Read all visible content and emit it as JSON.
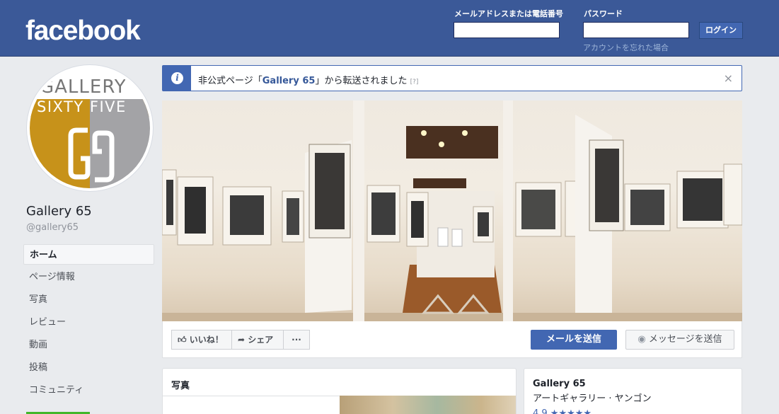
{
  "header": {
    "logo": "facebook",
    "email_label": "メールアドレスまたは電話番号",
    "password_label": "パスワード",
    "login_button": "ログイン",
    "forgot_link": "アカウントを忘れた場合",
    "brand_color": "#3b5998"
  },
  "profile": {
    "avatar_text_1": "GALLERY",
    "avatar_text_2": "SIXTY FIVE",
    "name": "Gallery 65",
    "handle": "@gallery65"
  },
  "sidebar": {
    "items": [
      {
        "label": "ホーム",
        "active": true
      },
      {
        "label": "ページ情報"
      },
      {
        "label": "写真"
      },
      {
        "label": "レビュー"
      },
      {
        "label": "動画"
      },
      {
        "label": "投稿"
      },
      {
        "label": "コミュニティ"
      }
    ]
  },
  "notice": {
    "prefix": "非公式ページ「",
    "page": "Gallery 65",
    "suffix": "」から転送されました",
    "help": "[?]",
    "close": "×"
  },
  "actions": {
    "like": "いいね！",
    "share": "シェア",
    "more": "···",
    "send_mail": "メールを送信",
    "send_message": "メッセージを送信"
  },
  "photos_card": {
    "title": "写真"
  },
  "info_card": {
    "name": "Gallery 65",
    "category": "アートギャラリー · ヤンゴン",
    "rating": "4.9 ★★★★★"
  }
}
